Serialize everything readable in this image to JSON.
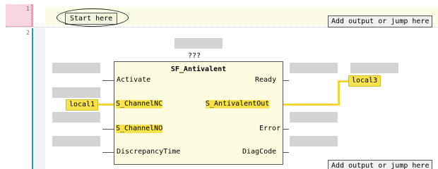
{
  "rungs": {
    "row1_number": "1",
    "row2_number": "2"
  },
  "labels": {
    "start_here": "Start here",
    "add_output_top": "Add output or jump here",
    "add_output_bottom": "Add output or jump here"
  },
  "function_block": {
    "instance_name": "???",
    "type_name": "SF_Antivalent",
    "inputs": [
      "Activate",
      "S_ChannelNC",
      "S_ChannelNO",
      "DiscrepancyTime"
    ],
    "outputs": [
      "Ready",
      "S_AntivalentOut",
      "Error",
      "DiagCode"
    ]
  },
  "variables": {
    "input_nc": "local1",
    "output_antivalent": "local3"
  },
  "colors": {
    "highlight": "#f6e24c",
    "rail": "#2aa198",
    "row1_marker": "#f8d6e0"
  }
}
